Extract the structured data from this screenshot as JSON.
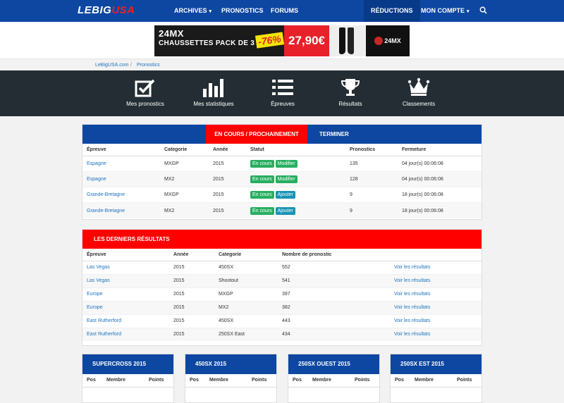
{
  "logo": {
    "white": "LEBIG",
    "red": "USA"
  },
  "nav": {
    "archives": "ARCHIVES",
    "pronostics": "PRONOSTICS",
    "forums": "FORUMS",
    "reductions": "RÉDUCTIONS",
    "account": "MON COMPTE"
  },
  "banner": {
    "line1": "24MX",
    "line2": "CHAUSSETTES PACK DE 3",
    "discount": "-76%",
    "price": "27,90€",
    "brand": "24MX"
  },
  "breadcrumb": {
    "home": "LeBigUSA.com",
    "sep": "/",
    "current": "Pronostics"
  },
  "dashboard": {
    "items": [
      {
        "label": "Mes pronostics"
      },
      {
        "label": "Mes statistiques"
      },
      {
        "label": "Épreuves"
      },
      {
        "label": "Résultats"
      },
      {
        "label": "Classements"
      }
    ]
  },
  "upcoming": {
    "tab_active": "EN COURS / PROCHAINEMENT",
    "tab_other": "TERMINER",
    "headers": [
      "Épreuve",
      "Categorie",
      "Année",
      "Statut",
      "Pronostics",
      "Fermeture"
    ],
    "rows": [
      {
        "epreuve": "Espagne",
        "categorie": "MXGP",
        "annee": "2015",
        "statut": "En cours",
        "action": "Modifier",
        "pronostics": "135",
        "fermeture": "04 jour(s) 00:06:08"
      },
      {
        "epreuve": "Espagne",
        "categorie": "MX2",
        "annee": "2015",
        "statut": "En cours",
        "action": "Modifier",
        "pronostics": "128",
        "fermeture": "04 jour(s) 00:06:08"
      },
      {
        "epreuve": "Grande-Bretagne",
        "categorie": "MXGP",
        "annee": "2015",
        "statut": "En cours",
        "action": "Ajouter",
        "pronostics": "9",
        "fermeture": "18 jour(s) 00:06:08"
      },
      {
        "epreuve": "Grande-Bretagne",
        "categorie": "MX2",
        "annee": "2015",
        "statut": "En cours",
        "action": "Ajouter",
        "pronostics": "9",
        "fermeture": "18 jour(s) 00:06:08"
      }
    ]
  },
  "results": {
    "title": "LES DERNIERS RÉSULTATS",
    "headers": [
      "Épreuve",
      "Année",
      "Categorie",
      "Nombre de pronostic",
      ""
    ],
    "link_label": "Voir les résultats",
    "rows": [
      {
        "epreuve": "Las Vegas",
        "annee": "2015",
        "categorie": "450SX",
        "nombre": "552"
      },
      {
        "epreuve": "Las Vegas",
        "annee": "2015",
        "categorie": "Shootout",
        "nombre": "541"
      },
      {
        "epreuve": "Europe",
        "annee": "2015",
        "categorie": "MXGP",
        "nombre": "397"
      },
      {
        "epreuve": "Europe",
        "annee": "2015",
        "categorie": "MX2",
        "nombre": "382"
      },
      {
        "epreuve": "East Rutherford",
        "annee": "2015",
        "categorie": "450SX",
        "nombre": "443"
      },
      {
        "epreuve": "East Rutherford",
        "annee": "2015",
        "categorie": "250SX East",
        "nombre": "434"
      }
    ]
  },
  "standings": {
    "headers": [
      "Pos",
      "Membre",
      "Points"
    ],
    "boxes": [
      {
        "title": "SUPERCROSS 2015"
      },
      {
        "title": "450SX 2015"
      },
      {
        "title": "250SX OUEST 2015"
      },
      {
        "title": "250SX EST 2015"
      }
    ]
  },
  "colors": {
    "primary": "#0d47a1",
    "accent": "#ff0000",
    "dark": "#232d33",
    "link": "#1e73be",
    "green": "#27ae60",
    "teal": "#1a93b5"
  }
}
